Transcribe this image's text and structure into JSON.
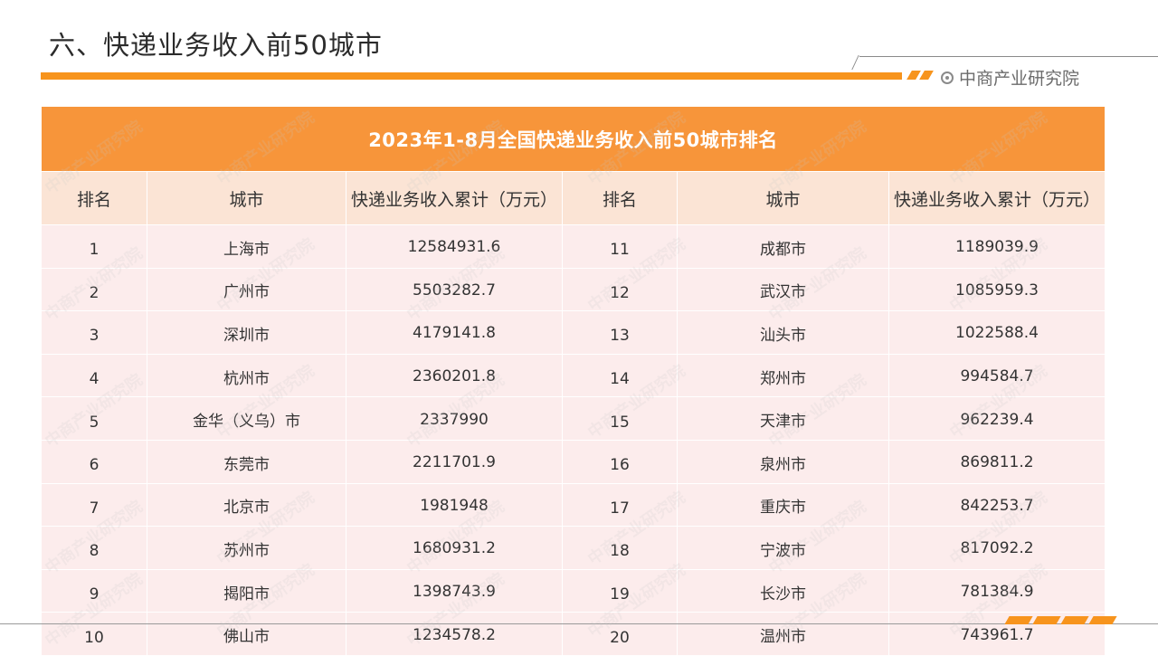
{
  "page": {
    "title": "六、快递业务收入前50城市",
    "brand": "中商产业研究院",
    "watermark": "中商产业研究院"
  },
  "colors": {
    "accent": "#f7941d",
    "table_header_bg": "#f7953a",
    "column_header_bg": "#fbe4d5",
    "cell_bg": "#fcecec"
  },
  "icons": {
    "brand": "brand-logo-icon"
  },
  "table": {
    "title": "2023年1-8月全国快递业务收入前50城市排名",
    "columns": [
      "排名",
      "城市",
      "快递业务收入累计（万元）",
      "排名",
      "城市",
      "快递业务收入累计（万元）"
    ],
    "rows": [
      [
        "1",
        "上海市",
        "12584931.6",
        "11",
        "成都市",
        "1189039.9"
      ],
      [
        "2",
        "广州市",
        "5503282.7",
        "12",
        "武汉市",
        "1085959.3"
      ],
      [
        "3",
        "深圳市",
        "4179141.8",
        "13",
        "汕头市",
        "1022588.4"
      ],
      [
        "4",
        "杭州市",
        "2360201.8",
        "14",
        "郑州市",
        "994584.7"
      ],
      [
        "5",
        "金华（义乌）市",
        "2337990",
        "15",
        "天津市",
        "962239.4"
      ],
      [
        "6",
        "东莞市",
        "2211701.9",
        "16",
        "泉州市",
        "869811.2"
      ],
      [
        "7",
        "北京市",
        "1981948",
        "17",
        "重庆市",
        "842253.7"
      ],
      [
        "8",
        "苏州市",
        "1680931.2",
        "18",
        "宁波市",
        "817092.2"
      ],
      [
        "9",
        "揭阳市",
        "1398743.9",
        "19",
        "长沙市",
        "781384.9"
      ],
      [
        "10",
        "佛山市",
        "1234578.2",
        "20",
        "温州市",
        "743961.7"
      ]
    ]
  }
}
